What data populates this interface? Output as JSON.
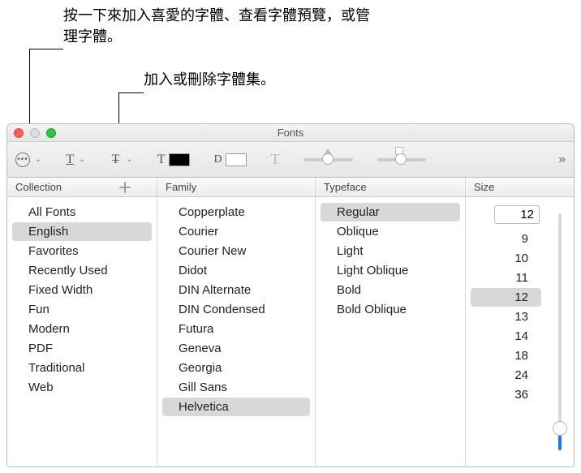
{
  "annotations": {
    "callout1": "按一下來加入喜愛的字體、查看字體預覽，或管理字體。",
    "callout2": "加入或刪除字體集。"
  },
  "window": {
    "title": "Fonts"
  },
  "headers": {
    "collection": "Collection",
    "family": "Family",
    "typeface": "Typeface",
    "size": "Size"
  },
  "collections": [
    {
      "label": "All Fonts",
      "selected": false
    },
    {
      "label": "English",
      "selected": true
    },
    {
      "label": "Favorites",
      "selected": false
    },
    {
      "label": "Recently Used",
      "selected": false
    },
    {
      "label": "Fixed Width",
      "selected": false
    },
    {
      "label": "Fun",
      "selected": false
    },
    {
      "label": "Modern",
      "selected": false
    },
    {
      "label": "PDF",
      "selected": false
    },
    {
      "label": "Traditional",
      "selected": false
    },
    {
      "label": "Web",
      "selected": false
    }
  ],
  "families": [
    {
      "label": "Copperplate",
      "selected": false
    },
    {
      "label": "Courier",
      "selected": false
    },
    {
      "label": "Courier New",
      "selected": false
    },
    {
      "label": "Didot",
      "selected": false
    },
    {
      "label": "DIN Alternate",
      "selected": false
    },
    {
      "label": "DIN Condensed",
      "selected": false
    },
    {
      "label": "Futura",
      "selected": false
    },
    {
      "label": "Geneva",
      "selected": false
    },
    {
      "label": "Georgia",
      "selected": false
    },
    {
      "label": "Gill Sans",
      "selected": false
    },
    {
      "label": "Helvetica",
      "selected": true
    }
  ],
  "typefaces": [
    {
      "label": "Regular",
      "selected": true
    },
    {
      "label": "Oblique",
      "selected": false
    },
    {
      "label": "Light",
      "selected": false
    },
    {
      "label": "Light Oblique",
      "selected": false
    },
    {
      "label": "Bold",
      "selected": false
    },
    {
      "label": "Bold Oblique",
      "selected": false
    }
  ],
  "size": {
    "current": "12",
    "options": [
      {
        "label": "9",
        "selected": false
      },
      {
        "label": "10",
        "selected": false
      },
      {
        "label": "11",
        "selected": false
      },
      {
        "label": "12",
        "selected": true
      },
      {
        "label": "13",
        "selected": false
      },
      {
        "label": "14",
        "selected": false
      },
      {
        "label": "18",
        "selected": false
      },
      {
        "label": "24",
        "selected": false
      },
      {
        "label": "36",
        "selected": false
      }
    ]
  },
  "toolbar_letters": {
    "underline": "T",
    "strike": "T",
    "textcolor": "T",
    "doc": "D",
    "effect": "T"
  }
}
